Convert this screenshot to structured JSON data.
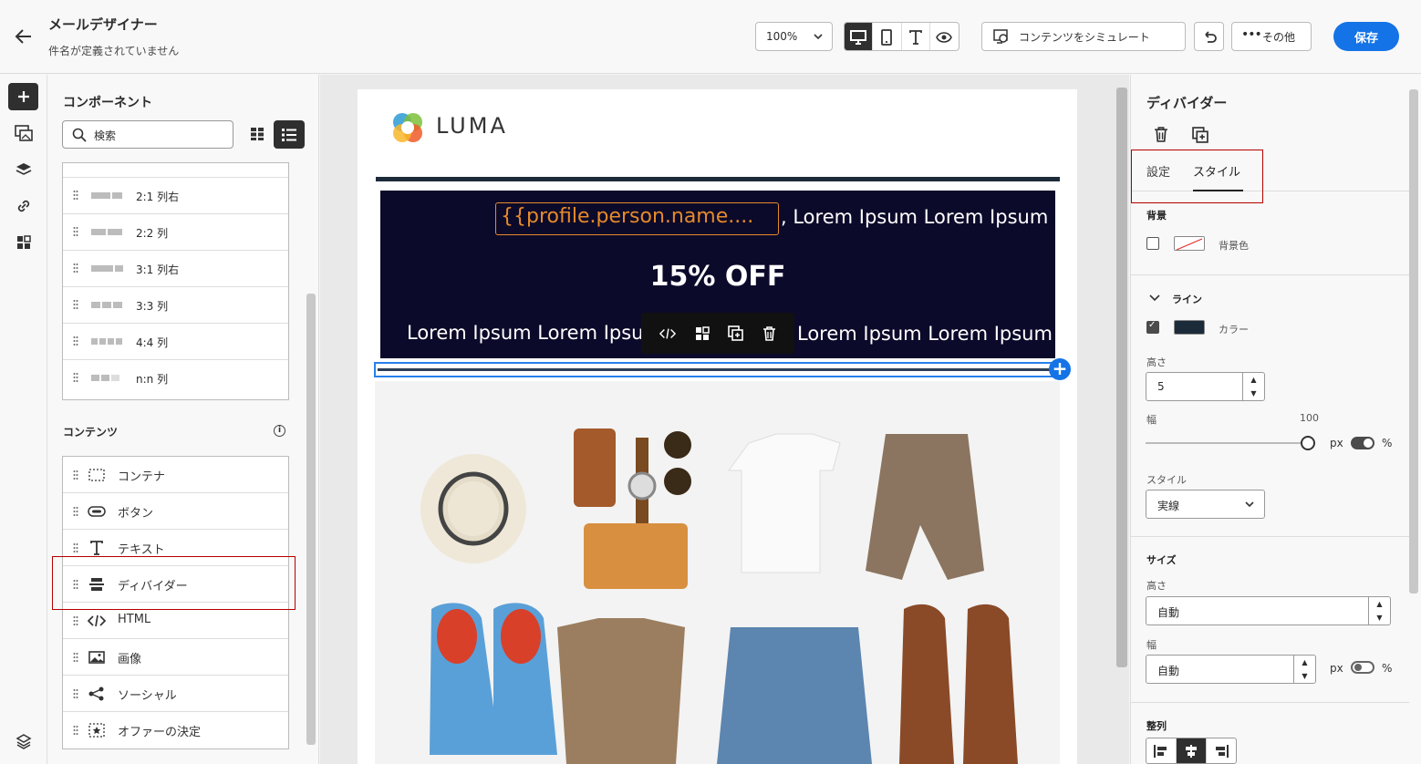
{
  "header": {
    "title": "メールデザイナー",
    "subtitle": "件名が定義されていません",
    "zoom": "100%",
    "simulate_label": "コンテンツをシミュレート",
    "more_label": "その他",
    "save_label": "保存"
  },
  "left_panel": {
    "title": "コンポーネント",
    "search_placeholder": "検索",
    "columns": [
      {
        "label": "2:1 列右"
      },
      {
        "label": "2:2 列"
      },
      {
        "label": "3:1 列右"
      },
      {
        "label": "3:3 列"
      },
      {
        "label": "4:4 列"
      },
      {
        "label": "n:n 列"
      }
    ],
    "content_title": "コンテンツ",
    "content_items": [
      {
        "label": "コンテナ"
      },
      {
        "label": "ボタン"
      },
      {
        "label": "テキスト"
      },
      {
        "label": "ディバイダー"
      },
      {
        "label": "HTML"
      },
      {
        "label": "画像"
      },
      {
        "label": "ソーシャル"
      },
      {
        "label": "オファーの決定"
      }
    ]
  },
  "email": {
    "logo_text": "LUMA",
    "personalization": "{{profile.person.name....",
    "line1_suffix": ", Lorem Ipsum Lorem Ipsum",
    "offer": "15% OFF",
    "line2_left": "Lorem Ipsum Lorem Ipsum",
    "line2_right": "Lorem Ipsum Lorem Ipsum"
  },
  "right_panel": {
    "title": "ディバイダー",
    "tab_settings": "設定",
    "tab_style": "スタイル",
    "background_section": "背景",
    "background_color_label": "背景色",
    "line_section": "ライン",
    "color_label": "カラー",
    "line_color": "#1c2b3a",
    "height_label": "高さ",
    "height_value": "5",
    "width_label": "幅",
    "width_value": "100",
    "unit_px": "px",
    "unit_pct": "%",
    "style_label": "スタイル",
    "style_value": "実線",
    "size_section": "サイズ",
    "size_height_label": "高さ",
    "size_height_value": "自動",
    "size_width_label": "幅",
    "size_width_value": "自動",
    "align_section": "整列"
  },
  "colors": {
    "accent": "#1473e6",
    "highlight": "#b40000",
    "banner": "#0c0a2a"
  }
}
